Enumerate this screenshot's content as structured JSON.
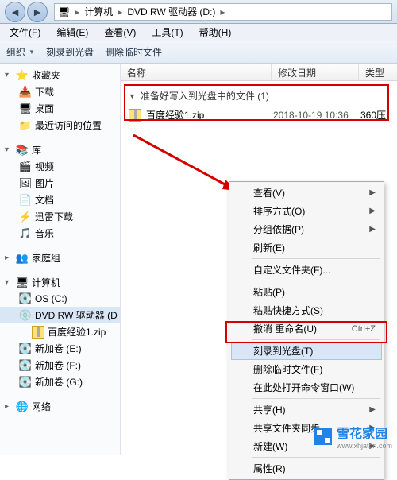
{
  "breadcrumb": {
    "seg1": "计算机",
    "seg2": "DVD RW 驱动器 (D:)"
  },
  "menubar": [
    {
      "label": "文件(F)"
    },
    {
      "label": "编辑(E)"
    },
    {
      "label": "查看(V)"
    },
    {
      "label": "工具(T)"
    },
    {
      "label": "帮助(H)"
    }
  ],
  "toolbar": {
    "organize": "组织",
    "burn": "刻录到光盘",
    "delete_temp": "删除临时文件"
  },
  "sidebar": {
    "favorites": {
      "label": "收藏夹",
      "items": [
        "下载",
        "桌面",
        "最近访问的位置"
      ]
    },
    "libraries": {
      "label": "库",
      "items": [
        "视频",
        "图片",
        "文档",
        "迅雷下载",
        "音乐"
      ]
    },
    "homegroup": {
      "label": "家庭组"
    },
    "computer": {
      "label": "计算机",
      "items": [
        "OS (C:)",
        "DVD RW 驱动器 (D",
        "百度经验1.zip",
        "新加卷 (E:)",
        "新加卷 (F:)",
        "新加卷 (G:)"
      ]
    },
    "network": {
      "label": "网络"
    }
  },
  "columns": {
    "name": "名称",
    "date": "修改日期",
    "type": "类型"
  },
  "files": {
    "section_title": "准备好写入到光盘中的文件 (1)",
    "items": [
      {
        "name": "百度经验1.zip",
        "date": "2018-10-19 10:36",
        "type": "360压"
      }
    ]
  },
  "context_menu": {
    "view": "查看(V)",
    "sort": "排序方式(O)",
    "group": "分组依据(P)",
    "refresh": "刷新(E)",
    "customize": "自定义文件夹(F)...",
    "paste": "粘贴(P)",
    "paste_shortcut": "粘贴快捷方式(S)",
    "undo_rename": "撤消 重命名(U)",
    "undo_hotkey": "Ctrl+Z",
    "burn": "刻录到光盘(T)",
    "delete_temp": "删除临时文件(F)",
    "open_cmd": "在此处打开命令窗口(W)",
    "share": "共享(H)",
    "share_sync": "共享文件夹同步",
    "new": "新建(W)",
    "properties": "属性(R)"
  },
  "watermark": {
    "name": "雪花家园",
    "url": "www.xhjaton.com"
  }
}
